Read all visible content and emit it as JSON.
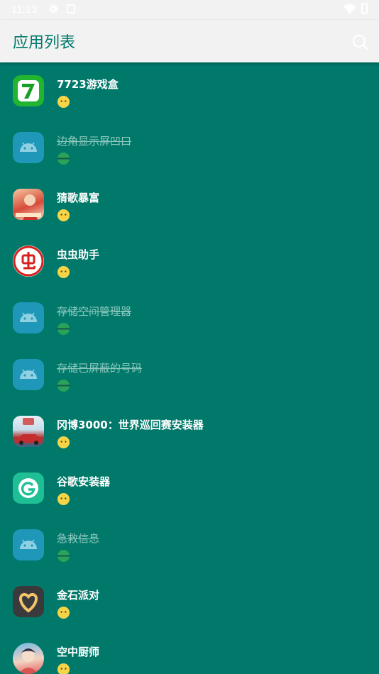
{
  "status_bar": {
    "time": "11:13"
  },
  "app_bar": {
    "title": "应用列表"
  },
  "apps": [
    {
      "name": "7723游戏盒",
      "icon": "7723-game-box-icon",
      "disabled": false
    },
    {
      "name": "边角显示屏凹口",
      "icon": "android-default-icon",
      "disabled": true
    },
    {
      "name": "猜歌暴富",
      "icon": "guess-song-icon",
      "disabled": false
    },
    {
      "name": "虫虫助手",
      "icon": "chongchong-helper-icon",
      "disabled": false
    },
    {
      "name": "存储空间管理器",
      "icon": "android-default-icon",
      "disabled": true
    },
    {
      "name": "存储已屏蔽的号码",
      "icon": "android-default-icon",
      "disabled": true
    },
    {
      "name": "冈博3000：世界巡回赛安装器",
      "icon": "racing-game-icon",
      "disabled": false
    },
    {
      "name": "谷歌安装器",
      "icon": "google-installer-icon",
      "disabled": false
    },
    {
      "name": "急救信息",
      "icon": "android-default-icon",
      "disabled": true
    },
    {
      "name": "金石派对",
      "icon": "jinshi-party-icon",
      "disabled": false
    },
    {
      "name": "空中厨师",
      "icon": "sky-chef-icon",
      "disabled": false
    }
  ],
  "colors": {
    "background": "#00796B",
    "app_bar": "#f2f2f2",
    "accent": "#00796B",
    "enabled_status": "#f5d547",
    "disabled_status": "#2aa35a"
  }
}
